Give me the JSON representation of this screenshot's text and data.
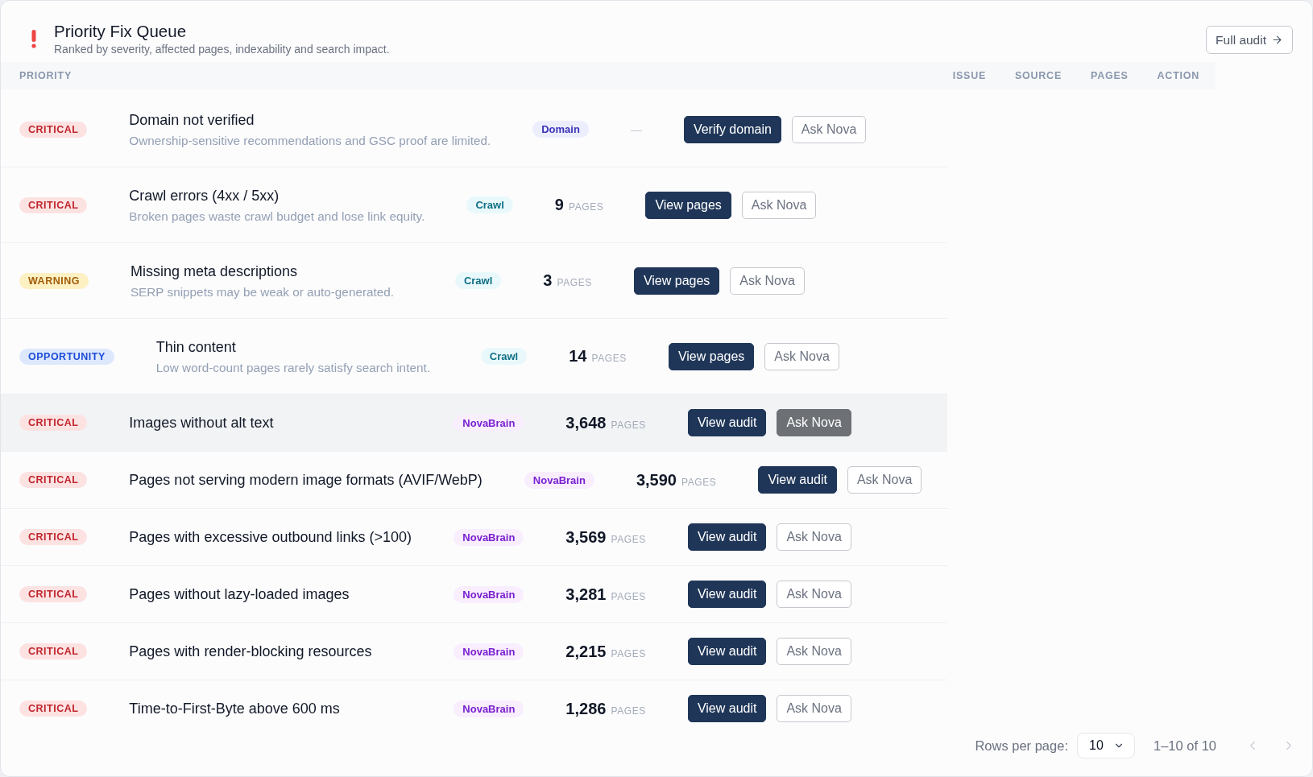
{
  "header": {
    "title": "Priority Fix Queue",
    "subtitle": "Ranked by severity, affected pages, indexability and search impact.",
    "action": {
      "label": "Full audit"
    }
  },
  "table": {
    "columns": [
      {
        "label": "PRIORITY"
      },
      {
        "label": "ISSUE"
      },
      {
        "label": "SOURCE"
      },
      {
        "label": "PAGES"
      },
      {
        "label": "ACTION"
      }
    ],
    "rows": [
      {
        "priority": {
          "label": "CRITICAL",
          "kind": "critical"
        },
        "title": "Domain not verified",
        "description": "Ownership-sensitive recommendations and GSC proof are limited.",
        "source": {
          "label": "Domain",
          "kind": "domain"
        },
        "pages": {
          "kind": "none",
          "value": "—"
        },
        "actions": [
          {
            "label": "Verify domain",
            "kind": "primary"
          },
          {
            "label": "Ask Nova",
            "kind": "secondary"
          }
        ],
        "hovered": false
      },
      {
        "priority": {
          "label": "CRITICAL",
          "kind": "critical"
        },
        "title": "Crawl errors (4xx / 5xx)",
        "description": "Broken pages waste crawl budget and lose link equity.",
        "source": {
          "label": "Crawl",
          "kind": "crawl"
        },
        "pages": {
          "kind": "count",
          "value": "9",
          "unit": "PAGES"
        },
        "actions": [
          {
            "label": "View pages",
            "kind": "primary"
          },
          {
            "label": "Ask Nova",
            "kind": "secondary"
          }
        ],
        "hovered": false
      },
      {
        "priority": {
          "label": "WARNING",
          "kind": "warning"
        },
        "title": "Missing meta descriptions",
        "description": "SERP snippets may be weak or auto-generated.",
        "source": {
          "label": "Crawl",
          "kind": "crawl"
        },
        "pages": {
          "kind": "count",
          "value": "3",
          "unit": "PAGES"
        },
        "actions": [
          {
            "label": "View pages",
            "kind": "primary"
          },
          {
            "label": "Ask Nova",
            "kind": "secondary"
          }
        ],
        "hovered": false
      },
      {
        "priority": {
          "label": "OPPORTUNITY",
          "kind": "opportunity"
        },
        "title": "Thin content",
        "description": "Low word-count pages rarely satisfy search intent.",
        "source": {
          "label": "Crawl",
          "kind": "crawl"
        },
        "pages": {
          "kind": "count",
          "value": "14",
          "unit": "PAGES"
        },
        "actions": [
          {
            "label": "View pages",
            "kind": "primary"
          },
          {
            "label": "Ask Nova",
            "kind": "secondary"
          }
        ],
        "hovered": false
      },
      {
        "priority": {
          "label": "CRITICAL",
          "kind": "critical"
        },
        "title": "Images without alt text",
        "source": {
          "label": "NovaBrain",
          "kind": "novabrain"
        },
        "pages": {
          "kind": "count",
          "value": "3,648",
          "unit": "PAGES"
        },
        "actions": [
          {
            "label": "View audit",
            "kind": "primary"
          },
          {
            "label": "Ask Nova",
            "kind": "secondary"
          }
        ],
        "hovered": true
      },
      {
        "priority": {
          "label": "CRITICAL",
          "kind": "critical"
        },
        "title": "Pages not serving modern image formats (AVIF/WebP)",
        "source": {
          "label": "NovaBrain",
          "kind": "novabrain"
        },
        "pages": {
          "kind": "count",
          "value": "3,590",
          "unit": "PAGES"
        },
        "actions": [
          {
            "label": "View audit",
            "kind": "primary"
          },
          {
            "label": "Ask Nova",
            "kind": "secondary"
          }
        ],
        "hovered": false
      },
      {
        "priority": {
          "label": "CRITICAL",
          "kind": "critical"
        },
        "title": "Pages with excessive outbound links (>100)",
        "source": {
          "label": "NovaBrain",
          "kind": "novabrain"
        },
        "pages": {
          "kind": "count",
          "value": "3,569",
          "unit": "PAGES"
        },
        "actions": [
          {
            "label": "View audit",
            "kind": "primary"
          },
          {
            "label": "Ask Nova",
            "kind": "secondary"
          }
        ],
        "hovered": false
      },
      {
        "priority": {
          "label": "CRITICAL",
          "kind": "critical"
        },
        "title": "Pages without lazy-loaded images",
        "source": {
          "label": "NovaBrain",
          "kind": "novabrain"
        },
        "pages": {
          "kind": "count",
          "value": "3,281",
          "unit": "PAGES"
        },
        "actions": [
          {
            "label": "View audit",
            "kind": "primary"
          },
          {
            "label": "Ask Nova",
            "kind": "secondary"
          }
        ],
        "hovered": false
      },
      {
        "priority": {
          "label": "CRITICAL",
          "kind": "critical"
        },
        "title": "Pages with render-blocking resources",
        "source": {
          "label": "NovaBrain",
          "kind": "novabrain"
        },
        "pages": {
          "kind": "count",
          "value": "2,215",
          "unit": "PAGES"
        },
        "actions": [
          {
            "label": "View audit",
            "kind": "primary"
          },
          {
            "label": "Ask Nova",
            "kind": "secondary"
          }
        ],
        "hovered": false
      },
      {
        "priority": {
          "label": "CRITICAL",
          "kind": "critical"
        },
        "title": "Time-to-First-Byte above 600 ms",
        "source": {
          "label": "NovaBrain",
          "kind": "novabrain"
        },
        "pages": {
          "kind": "count",
          "value": "1,286",
          "unit": "PAGES"
        },
        "actions": [
          {
            "label": "View audit",
            "kind": "primary"
          },
          {
            "label": "Ask Nova",
            "kind": "secondary"
          }
        ],
        "hovered": false
      }
    ]
  },
  "pagination": {
    "rows_per_page_label": "Rows per page:",
    "rows_per_page": "10",
    "range": "1–10 of 10",
    "previous": {
      "disabled": true
    },
    "next": {
      "disabled": true
    }
  }
}
